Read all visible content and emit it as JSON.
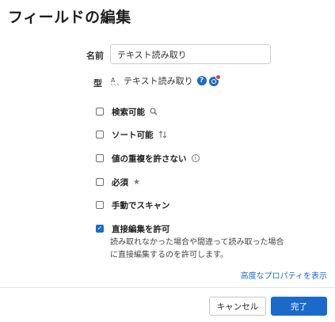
{
  "dialog": {
    "title": "フィールドの編集"
  },
  "name_field": {
    "label": "名前",
    "value": "テキスト読み取り"
  },
  "type_field": {
    "label": "型",
    "value": "テキスト読み取り",
    "help_icon_text": "?"
  },
  "options": [
    {
      "label": "検索可能",
      "checked": false,
      "icon": "search-icon"
    },
    {
      "label": "ソート可能",
      "checked": false,
      "icon": "sort-arrows-icon"
    },
    {
      "label": "値の重複を許さない",
      "checked": false,
      "icon": "info-icon"
    },
    {
      "label": "必須",
      "checked": false,
      "icon": "star-icon"
    },
    {
      "label": "手動でスキャン",
      "checked": false,
      "icon": ""
    },
    {
      "label": "直接編集を許可",
      "checked": true,
      "icon": ""
    }
  ],
  "direct_edit_description": "読み取れなかった場合や間違って読み取った場合に直接編集するのを許可します。",
  "advanced_link": "高度なプロパティを表示",
  "buttons": {
    "cancel": "キャンセル",
    "done": "完了"
  },
  "colors": {
    "accent": "#1b6ac9",
    "badge_alert": "#e43b3b"
  }
}
